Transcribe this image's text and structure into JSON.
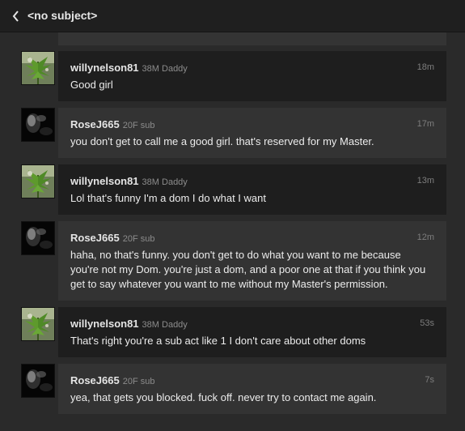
{
  "header": {
    "title": "<no subject>"
  },
  "messages": [
    {
      "username": "willynelson81",
      "tag": "38M Daddy",
      "time": "18m",
      "text": "Good girl",
      "avatar": "weed-plant-avatar"
    },
    {
      "username": "RoseJ665",
      "tag": "20F sub",
      "time": "17m",
      "text": "you don't get to call me a good girl. that's reserved for my Master.",
      "avatar": "dark-smoke-avatar"
    },
    {
      "username": "willynelson81",
      "tag": "38M Daddy",
      "time": "13m",
      "text": "Lol that's funny I'm a dom I do what I want",
      "avatar": "weed-plant-avatar"
    },
    {
      "username": "RoseJ665",
      "tag": "20F sub",
      "time": "12m",
      "text": "haha, no that's funny. you don't get to do what you want to me because you're not my Dom. you're just a dom, and a poor one at that if you think you get to say whatever you want to me without my Master's permission.",
      "avatar": "dark-smoke-avatar"
    },
    {
      "username": "willynelson81",
      "tag": "38M Daddy",
      "time": "53s",
      "text": "That's right you're a sub act like 1 I don't care about other doms",
      "avatar": "weed-plant-avatar"
    },
    {
      "username": "RoseJ665",
      "tag": "20F sub",
      "time": "7s",
      "text": "yea, that gets you blocked. fuck off. never try to contact me again.",
      "avatar": "dark-smoke-avatar"
    }
  ]
}
